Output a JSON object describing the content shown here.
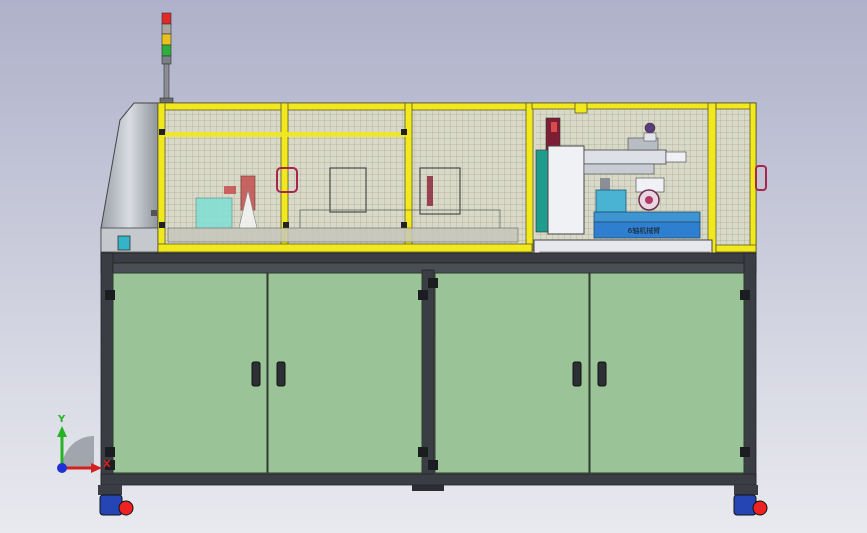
{
  "viewport": {
    "background_top": "#aeb1c9",
    "background_bottom": "#e9eaef"
  },
  "machine": {
    "frame_color": "#3a3d44",
    "guard_color": "#f2e81e",
    "cabinet_color": "#9ac497",
    "conveyor_label": "6轴机械臂",
    "conveyor_color": "#2f7fd1"
  },
  "signal_tower": {
    "lights": [
      "red",
      "yellow",
      "green"
    ]
  },
  "axis_triad": {
    "y_label": "Y",
    "x_label": "X",
    "y_color": "#27b327",
    "x_color": "#d42020",
    "z_color": "#2030d4"
  }
}
